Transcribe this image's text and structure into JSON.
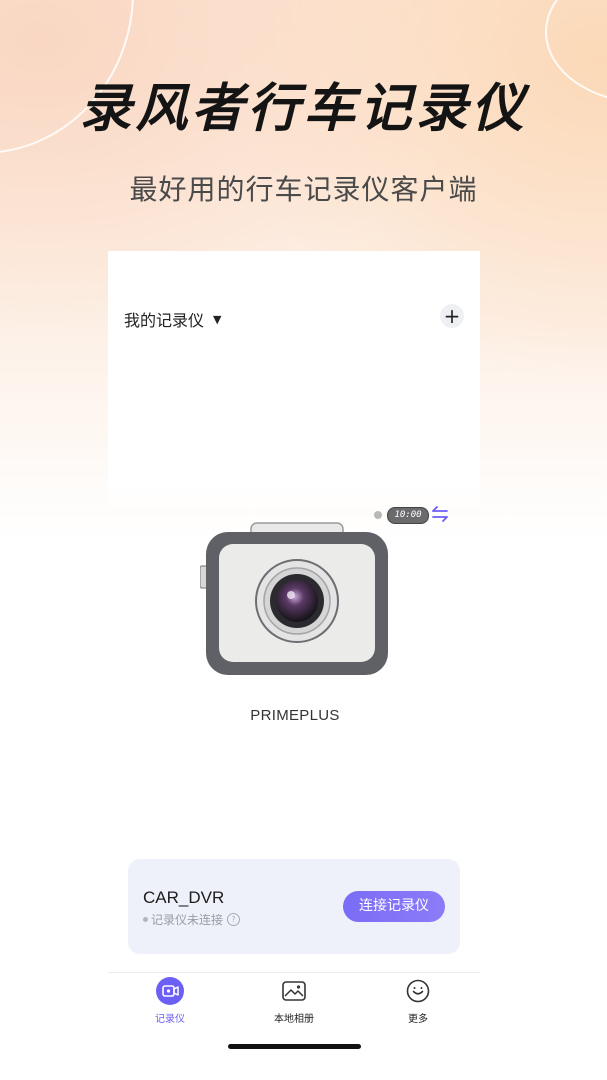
{
  "hero": {
    "title": "录风者行车记录仪",
    "subtitle": "最好用的行车记录仪客户端"
  },
  "app": {
    "device_selector_label": "我的记录仪",
    "add_button_glyph": "+",
    "clock_text": "10:00",
    "device_model": "PRIMEPLUS",
    "icons": [
      "caret-down-icon",
      "add-icon",
      "status-dot-icon",
      "swap-icon",
      "camera-image",
      "help-icon",
      "dashcam-icon",
      "album-icon",
      "smile-icon"
    ]
  },
  "card": {
    "device_name": "CAR_DVR",
    "status_text": "记录仪未连接",
    "help_glyph": "?",
    "connect_label": "连接记录仪"
  },
  "tabs": [
    {
      "label": "记录仪",
      "active": true
    },
    {
      "label": "本地相册",
      "active": false
    },
    {
      "label": "更多",
      "active": false
    }
  ],
  "colors": {
    "accent": "#6c5ff5",
    "button_gradient_start": "#7b6cf6",
    "card_background": "#eef1fa",
    "camera_body": "#5f6166"
  }
}
